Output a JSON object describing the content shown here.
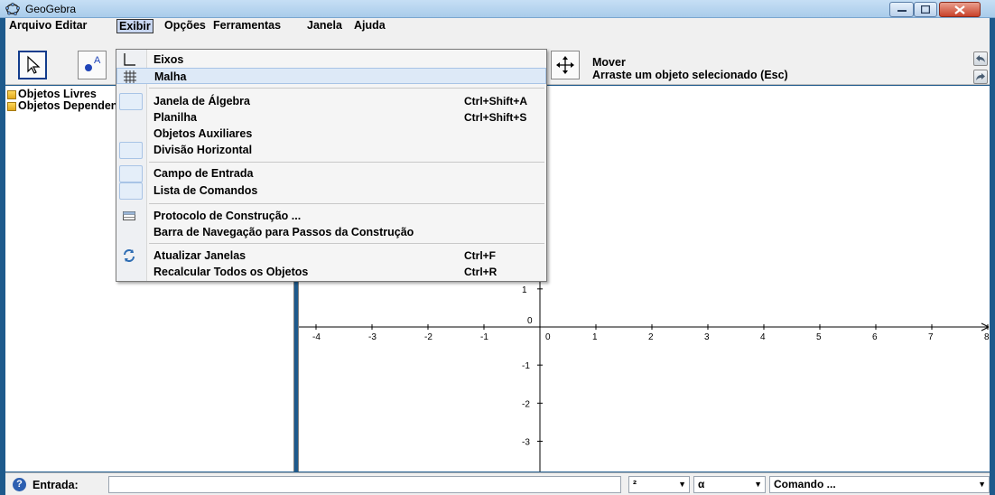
{
  "window": {
    "title": "GeoGebra"
  },
  "menubar": {
    "items": [
      {
        "label": "Arquivo"
      },
      {
        "label": "Editar"
      },
      {
        "label": "Exibir"
      },
      {
        "label": "Opções"
      },
      {
        "label": "Ferramentas"
      },
      {
        "label": "Janela"
      },
      {
        "label": "Ajuda"
      }
    ]
  },
  "toolbar": {
    "info_title": "Mover",
    "info_desc": "Arraste um objeto selecionado (Esc)"
  },
  "algebra": {
    "items": [
      {
        "label": "Objetos Livres"
      },
      {
        "label": "Objetos Dependentes"
      }
    ]
  },
  "graphics": {
    "x_ticks": [
      "-4",
      "-3",
      "-2",
      "-1",
      "0",
      "1",
      "2",
      "3",
      "4",
      "5",
      "6",
      "7",
      "8"
    ],
    "y_ticks": [
      "1",
      "0",
      "-1",
      "-2",
      "-3"
    ]
  },
  "exibir_menu": {
    "items": [
      {
        "label": "Eixos",
        "shortcut": "",
        "icon": "axes-icon"
      },
      {
        "label": "Malha",
        "shortcut": "",
        "icon": "grid-icon"
      },
      {
        "label": "Janela de Álgebra",
        "shortcut": "Ctrl+Shift+A",
        "icon": "checkbox"
      },
      {
        "label": "Planilha",
        "shortcut": "Ctrl+Shift+S",
        "icon": ""
      },
      {
        "label": "Objetos Auxiliares",
        "shortcut": "",
        "icon": ""
      },
      {
        "label": "Divisão Horizontal",
        "shortcut": "",
        "icon": "checkbox"
      },
      {
        "label": "Campo de Entrada",
        "shortcut": "",
        "icon": "checkbox"
      },
      {
        "label": "Lista de Comandos",
        "shortcut": "",
        "icon": "checkbox"
      },
      {
        "label": "Protocolo de Construção ...",
        "shortcut": "",
        "icon": "table-icon"
      },
      {
        "label": "Barra de Navegação para Passos da Construção",
        "shortcut": "",
        "icon": ""
      },
      {
        "label": "Atualizar Janelas",
        "shortcut": "Ctrl+F",
        "icon": "refresh-icon"
      },
      {
        "label": "Recalcular Todos os Objetos",
        "shortcut": "Ctrl+R",
        "icon": ""
      }
    ]
  },
  "inputbar": {
    "label": "Entrada:",
    "value": "",
    "symbol_combo": "²",
    "greek_combo": "α",
    "command_combo": "Comando ..."
  }
}
